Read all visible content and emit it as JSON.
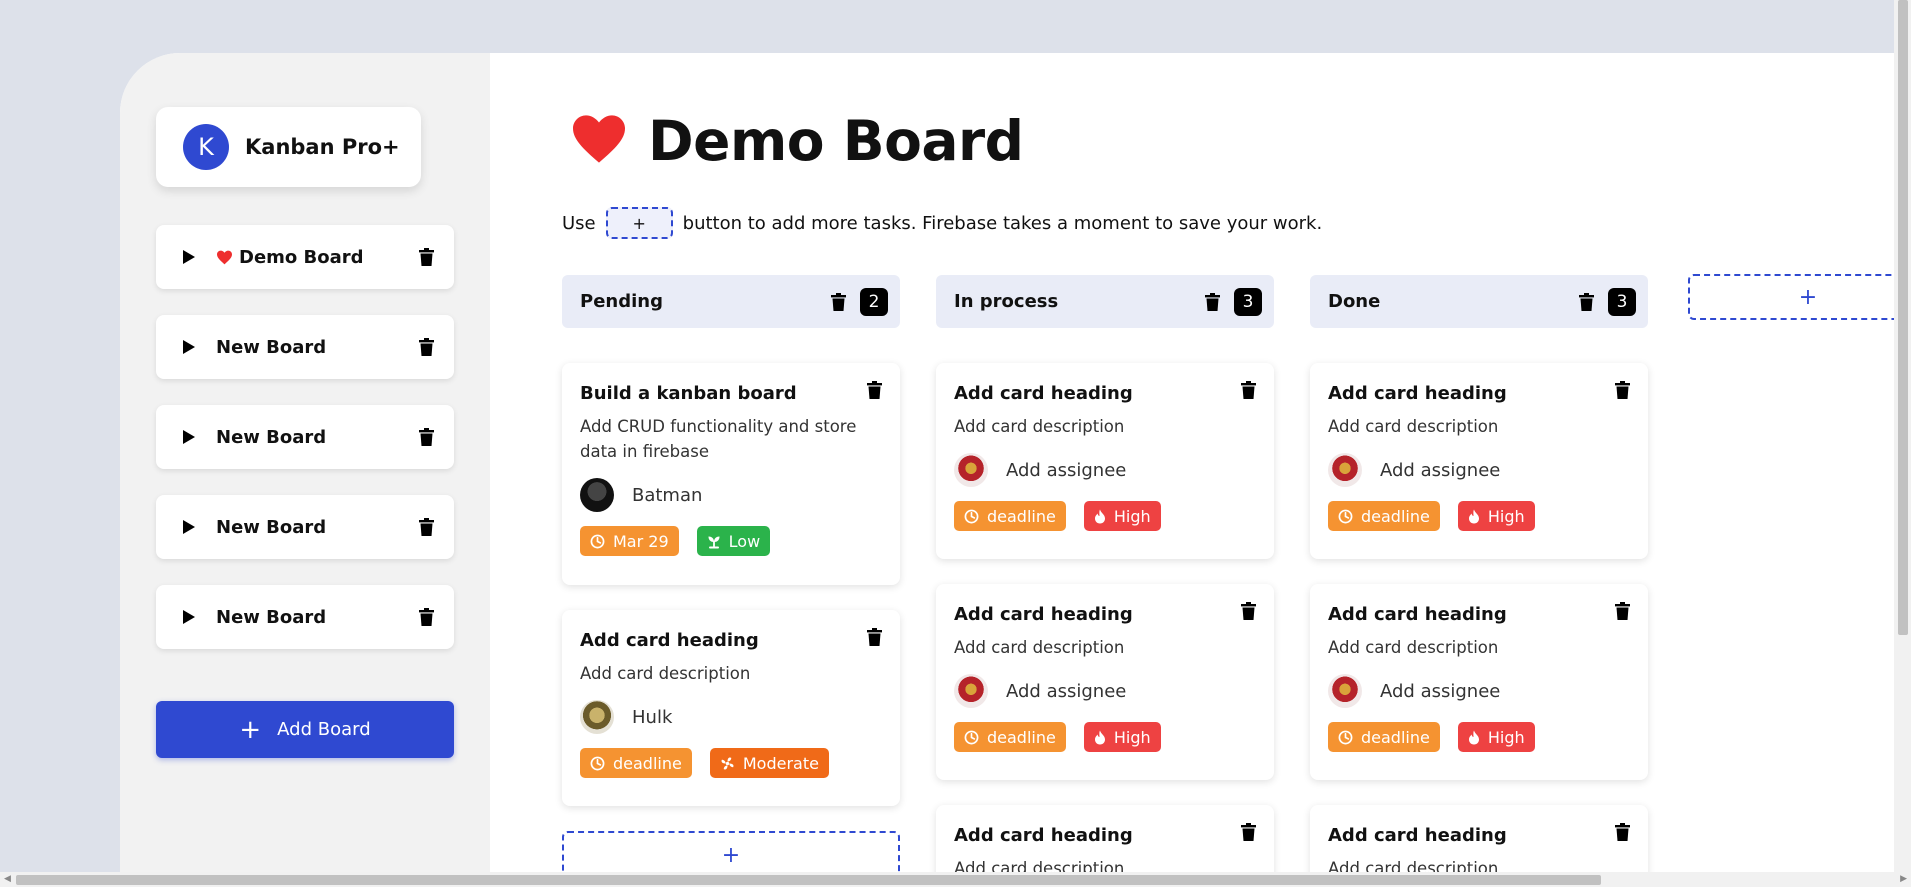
{
  "app": {
    "brand_initial": "K",
    "brand_name": "Kanban Pro+"
  },
  "sidebar": {
    "boards": [
      {
        "label": "Demo Board",
        "favorite": true
      },
      {
        "label": "New Board"
      },
      {
        "label": "New Board"
      },
      {
        "label": "New Board"
      },
      {
        "label": "New Board"
      }
    ],
    "add_board_label": "Add Board",
    "add_board_plus": "+"
  },
  "board": {
    "title": "Demo Board",
    "hint_before": "Use",
    "hint_button": "+",
    "hint_after": "button to add more tasks. Firebase takes a moment to save your work.",
    "add_column_label": "+",
    "add_card_label": "+",
    "columns": [
      {
        "title": "Pending",
        "count": "2",
        "cards": [
          {
            "heading": "Build a kanban board",
            "description": "Add CRUD functionality and store data in firebase",
            "assignee": "Batman",
            "date": "Mar 29",
            "priority": "Low"
          },
          {
            "heading": "Add card heading",
            "description": "Add card description",
            "assignee": "Hulk",
            "date": "deadline",
            "priority": "Moderate"
          }
        ]
      },
      {
        "title": "In process",
        "count": "3",
        "cards": [
          {
            "heading": "Add card heading",
            "description": "Add card description",
            "assignee": "Add assignee",
            "date": "deadline",
            "priority": "High"
          },
          {
            "heading": "Add card heading",
            "description": "Add card description",
            "assignee": "Add assignee",
            "date": "deadline",
            "priority": "High"
          },
          {
            "heading": "Add card heading",
            "description": "Add card description"
          }
        ]
      },
      {
        "title": "Done",
        "count": "3",
        "cards": [
          {
            "heading": "Add card heading",
            "description": "Add card description",
            "assignee": "Add assignee",
            "date": "deadline",
            "priority": "High"
          },
          {
            "heading": "Add card heading",
            "description": "Add card description",
            "assignee": "Add assignee",
            "date": "deadline",
            "priority": "High"
          },
          {
            "heading": "Add card heading",
            "description": "Add card description"
          }
        ]
      }
    ]
  },
  "icons": {
    "favorite": "heart-icon",
    "board_expand": "play-icon",
    "delete": "trash-icon",
    "deadline": "clock-icon",
    "high": "flame-icon",
    "low": "plant-icon",
    "moderate": "fan-icon"
  },
  "colors": {
    "accent": "#2f49d1",
    "heart": "#ee2e2e",
    "tag_date": "#f59331",
    "tag_high": "#ee4242",
    "tag_low": "#2bb34b",
    "tag_moderate": "#f06a18"
  }
}
